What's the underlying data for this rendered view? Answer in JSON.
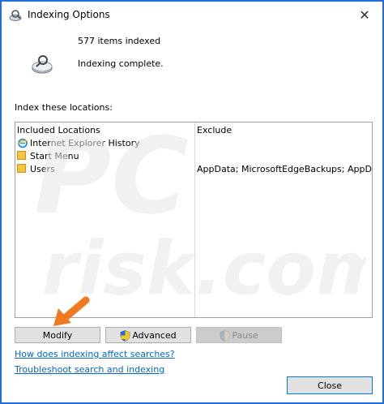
{
  "window": {
    "title": "Indexing Options",
    "close_glyph": "✕"
  },
  "status": {
    "items_indexed": "577 items indexed",
    "state": "Indexing complete."
  },
  "locations": {
    "label": "Index these locations:",
    "columns": {
      "included": "Included Locations",
      "exclude": "Exclude"
    },
    "rows": [
      {
        "icon": "internet-explorer-icon",
        "name": "Internet Explorer History",
        "exclude": ""
      },
      {
        "icon": "folder-icon",
        "name": "Start Menu",
        "exclude": ""
      },
      {
        "icon": "folder-icon",
        "name": "Users",
        "exclude": "AppData; MicrosoftEdgeBackups; AppData"
      }
    ]
  },
  "buttons": {
    "modify": "Modify",
    "advanced": "Advanced",
    "pause": "Pause",
    "close": "Close"
  },
  "links": {
    "affect": "How does indexing affect searches?",
    "troubleshoot": "Troubleshoot search and indexing"
  },
  "colors": {
    "window_border": "#1e6fd9",
    "link": "#0066cc",
    "annotation_arrow": "#f07a1f"
  }
}
